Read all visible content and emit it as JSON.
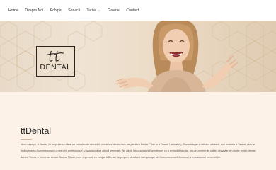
{
  "nav": {
    "items": [
      {
        "label": "Home"
      },
      {
        "label": "Despre Noi"
      },
      {
        "label": "Echipa"
      },
      {
        "label": "Servicii"
      },
      {
        "label": "Tarife",
        "has_dropdown": true
      },
      {
        "label": "Galerie"
      },
      {
        "label": "Contact"
      }
    ]
  },
  "hero": {
    "logo_text": "DENTAL",
    "logo_monogram": "tt"
  },
  "main": {
    "title": "ttDental",
    "paragraph": "Noul concept, tt Dental, își propune să ofere un complex de servicii în domeniul dental care, respectiv tt Dental Clinic și tt Dental Laboratory, Stomatologie și tehnică dentară, sub umbrela tt Dental, vine în întâmpinarea Dumneavoastră cu servicii profesioniste și apariatură de ultimă generație. Ne găsiți într-o ambianță primitoare, cu o echipă dedicată, într-un proiect de suflet, dezvoltat de doctor medic dentist Abrám Tímea și tehnician dentar Bányai Tünde, care împreună cu echipa tt Dental, își propun să aducă mai aproape de Dumneavoastră frumosul și entuziasmul meseriei lor."
  },
  "colors": {
    "hero_bg": "#ecdcc7",
    "content_bg": "#fdf2e7",
    "brand_dark": "#2b2420",
    "pattern_line": "#c9ad84"
  }
}
